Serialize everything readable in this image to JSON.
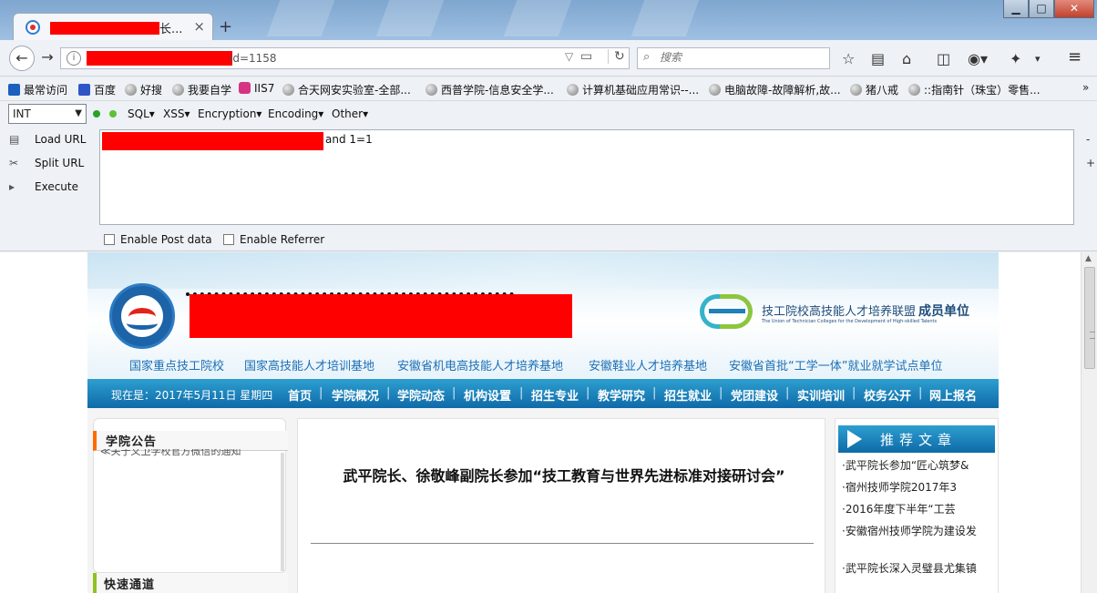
{
  "browser": {
    "tab": {
      "title_suffix": "长...",
      "close": "×"
    },
    "new_tab": "+",
    "window_controls": {
      "minimize": "▁",
      "maximize": "□",
      "close": "✕"
    },
    "url": {
      "visible_suffix": "id=1158"
    },
    "search": {
      "placeholder": "搜索"
    },
    "icons": [
      "back-arrow-icon",
      "forward-arrow-icon",
      "info-icon",
      "reader-icon",
      "reload-icon",
      "search-icon",
      "star-icon",
      "bookmark-list-icon",
      "home-icon",
      "pocket-icon",
      "addon-icon",
      "tools-icon",
      "menu-icon"
    ]
  },
  "bookmarks": [
    "最常访问",
    "百度",
    "好搜",
    "我要自学",
    "IIS7",
    "合天网安实验室-全部...",
    "西普学院-信息安全学...",
    "计算机基础应用常识--...",
    "电脑故障-故障解析,故...",
    "猪八戒",
    "::指南针（珠宝）零售..."
  ],
  "bookmarks_more": "»",
  "hackbar": {
    "select_value": "INT",
    "menus": [
      "SQL▾",
      "XSS▾",
      "Encryption▾",
      "Encoding▾",
      "Other▾"
    ],
    "actions": [
      "Load URL",
      "Split URL",
      "Execute"
    ],
    "payload_visible": "and 1=1",
    "side_minus": "-",
    "side_plus": "+",
    "checkboxes": [
      "Enable Post data",
      "Enable Referrer"
    ]
  },
  "site": {
    "alliance": {
      "name": "技工院校高技能人才培养联盟",
      "sub": "The Union of Technician Colleges for the Development of High-skilled Talents",
      "member": "成员单位"
    },
    "slogans": [
      "国家重点技工院校",
      "国家高技能人才培训基地",
      "安徽省机电高技能人才培养基地",
      "安徽鞋业人才培养基地",
      "安徽省首批“工学一体”就业就学试点单位"
    ],
    "date_text": "现在是：2017年5月11日 星期四",
    "nav": [
      "首页",
      "学院概况",
      "学院动态",
      "机构设置",
      "招生专业",
      "教学研究",
      "招生就业",
      "党团建设",
      "实训培训",
      "校务公开",
      "网上报名"
    ],
    "notice_title": "学院公告",
    "notice_scroll": "≪关于义卫学校官方微信的通知",
    "quick_title": "快速通道",
    "article_title": "武平院长、徐敬峰副院长参加“技工教育与世界先进标准对接研讨会”",
    "rec_title": "推荐文章",
    "rec_items": [
      "·武平院长参加“匠心筑梦&",
      "·宿州技师学院2017年3",
      "·2016年度下半年“工芸",
      "·安徽宿州技师学院为建设发",
      "·武平院长深入灵璧县尤集镇"
    ]
  },
  "colors": {
    "redaction": "#ff0000",
    "site_nav": "#0f6aa8",
    "slogan": "#1b6fb5"
  }
}
